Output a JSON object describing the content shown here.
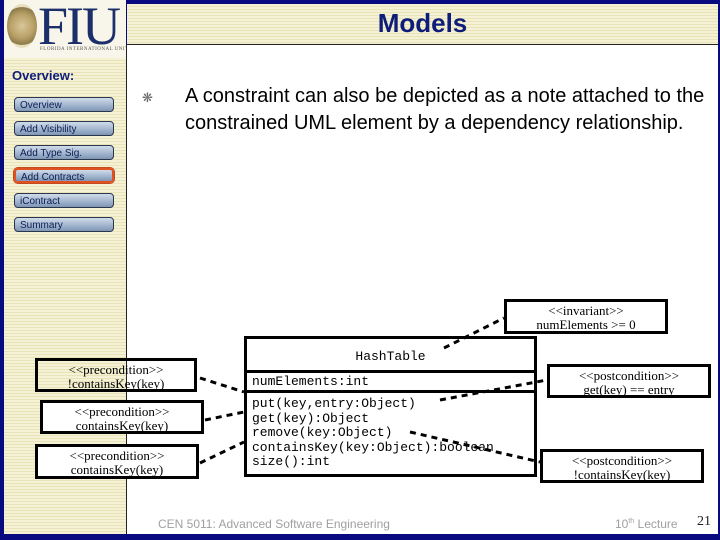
{
  "header": {
    "logo_text": "FIU",
    "logo_subtitle": "FLORIDA INTERNATIONAL UNIVERSITY",
    "title": "Models"
  },
  "sidebar": {
    "heading": "Overview:",
    "items": [
      {
        "label": "Overview",
        "active": false
      },
      {
        "label": "Add Visibility",
        "active": false
      },
      {
        "label": "Add Type Sig.",
        "active": false
      },
      {
        "label": "Add Contracts",
        "active": true
      },
      {
        "label": "iContract",
        "active": false
      },
      {
        "label": "Summary",
        "active": false
      }
    ]
  },
  "main": {
    "bullet_icon": "asterisk-bullet-icon",
    "bullet_text": "A constraint can also be depicted as a note attached to the constrained UML element by a dependency relationship."
  },
  "diagram": {
    "class": {
      "name": "HashTable",
      "attributes": [
        "numElements:int"
      ],
      "operations": [
        "put(key,entry:Object)",
        "get(key):Object",
        "remove(key:Object)",
        "containsKey(key:Object):boolean",
        "size():int"
      ]
    },
    "notes": [
      {
        "id": "invariant",
        "stereotype": "<<invariant>>",
        "expr": "numElements >= 0"
      },
      {
        "id": "pre1",
        "stereotype": "<<precondition>>",
        "expr": "!containsKey(key)"
      },
      {
        "id": "pre2",
        "stereotype": "<<precondition>>",
        "expr": "containsKey(key)"
      },
      {
        "id": "pre3",
        "stereotype": "<<precondition>>",
        "expr": "containsKey(key)"
      },
      {
        "id": "post1",
        "stereotype": "<<postcondition>>",
        "expr": "get(key) == entry"
      },
      {
        "id": "post2",
        "stereotype": "<<postcondition>>",
        "expr": "!containsKey(key)"
      }
    ]
  },
  "footer": {
    "course": "CEN 5011: Advanced Software Engineering",
    "lecture_num": "10",
    "lecture_sup": "th",
    "lecture_word": "Lecture",
    "page": "21"
  },
  "colors": {
    "frame": "#0a0a80",
    "title": "#0e1c7a",
    "active_outline": "#e05020"
  }
}
